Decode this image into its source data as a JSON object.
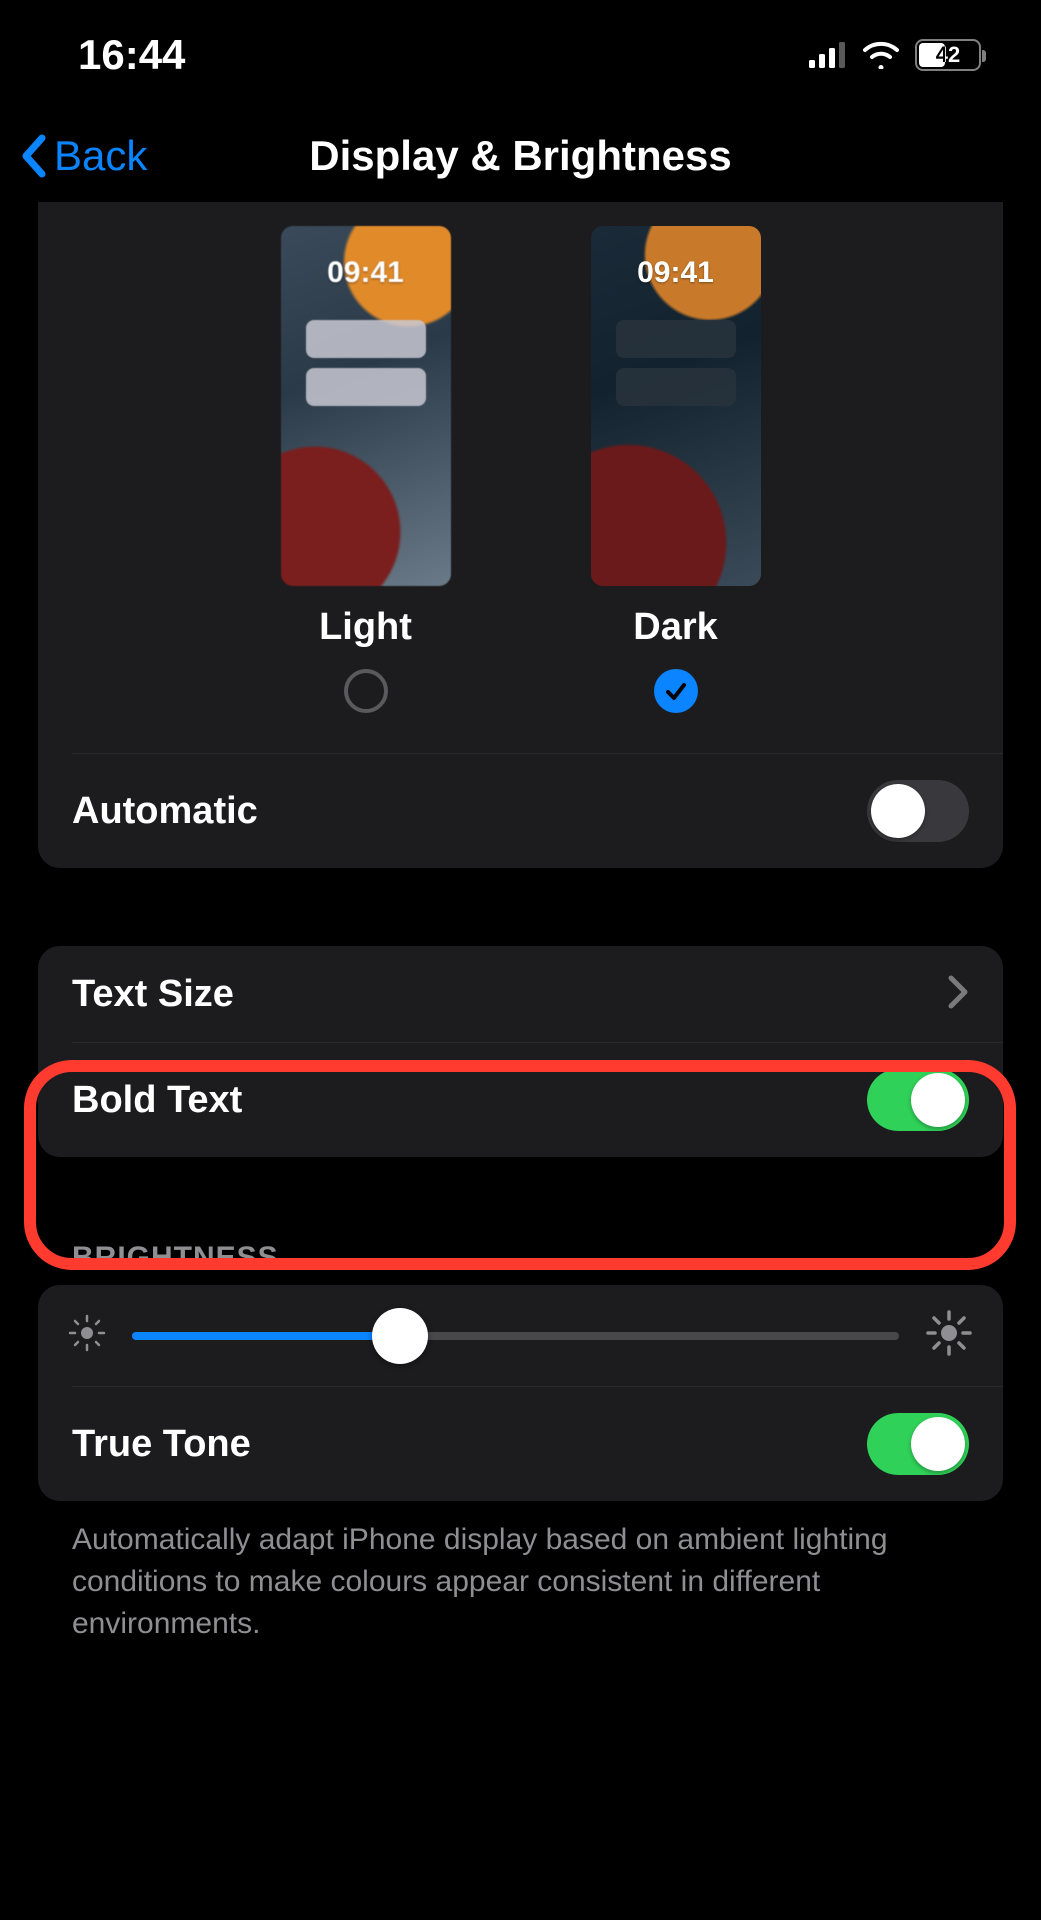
{
  "status": {
    "time": "16:44",
    "battery_percent": 42,
    "battery_fill_percent": 42
  },
  "nav": {
    "back_label": "Back",
    "title": "Display & Brightness"
  },
  "appearance": {
    "preview_time": "09:41",
    "light_label": "Light",
    "dark_label": "Dark",
    "selected": "dark",
    "automatic_label": "Automatic",
    "automatic_on": false
  },
  "text": {
    "text_size_label": "Text Size",
    "bold_text_label": "Bold Text",
    "bold_text_on": true
  },
  "brightness": {
    "section_label": "BRIGHTNESS",
    "value_percent": 35,
    "true_tone_label": "True Tone",
    "true_tone_on": true,
    "footer": "Automatically adapt iPhone display based on ambient lighting conditions to make colours appear consistent in different environments."
  },
  "colors": {
    "accent_blue": "#0a84ff",
    "toggle_green": "#30d158",
    "annotation_red": "#ff3b30"
  },
  "annotation": {
    "highlight_target": "brightness-section"
  }
}
